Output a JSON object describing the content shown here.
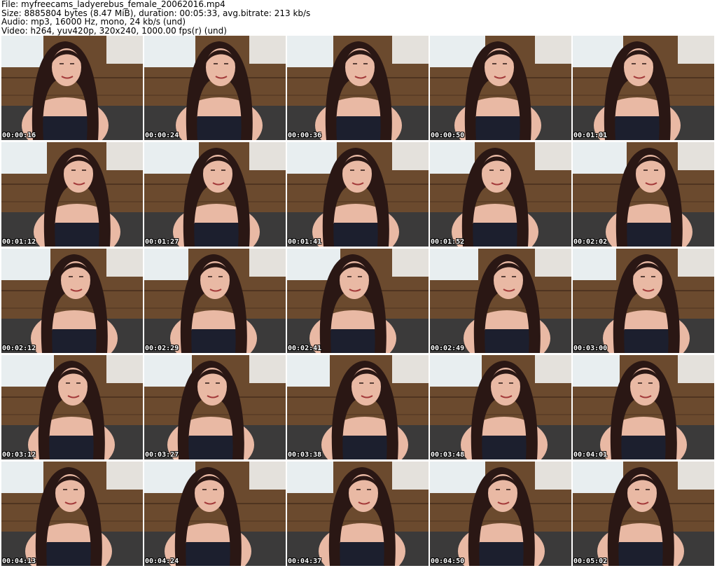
{
  "header": {
    "file": "File: myfreecams_ladyerebus_female_20062016.mp4",
    "size": "Size: 8885804 bytes (8.47 MiB), duration: 00:05:33, avg.bitrate: 213 kb/s",
    "audio": "Audio: mp3, 16000 Hz, mono, 24 kb/s (und)",
    "video": "Video: h264, yuv420p, 320x240, 1000.00 fps(r) (und)"
  },
  "thumbnails": [
    {
      "timestamp": "00:00:16"
    },
    {
      "timestamp": "00:00:24"
    },
    {
      "timestamp": "00:00:36"
    },
    {
      "timestamp": "00:00:50"
    },
    {
      "timestamp": "00:01:01"
    },
    {
      "timestamp": "00:01:12"
    },
    {
      "timestamp": "00:01:27"
    },
    {
      "timestamp": "00:01:41"
    },
    {
      "timestamp": "00:01:52"
    },
    {
      "timestamp": "00:02:02"
    },
    {
      "timestamp": "00:02:12"
    },
    {
      "timestamp": "00:02:29"
    },
    {
      "timestamp": "00:02:41"
    },
    {
      "timestamp": "00:02:49"
    },
    {
      "timestamp": "00:03:00"
    },
    {
      "timestamp": "00:03:12"
    },
    {
      "timestamp": "00:03:27"
    },
    {
      "timestamp": "00:03:38"
    },
    {
      "timestamp": "00:03:48"
    },
    {
      "timestamp": "00:04:01"
    },
    {
      "timestamp": "00:04:13"
    },
    {
      "timestamp": "00:04:24"
    },
    {
      "timestamp": "00:04:37"
    },
    {
      "timestamp": "00:04:50"
    },
    {
      "timestamp": "00:05:02"
    }
  ],
  "colors": {
    "wall": "#6b4a2e",
    "window": "#e8eef0",
    "hair": "#2a1714",
    "skin": "#e9b9a4",
    "dress": "#1c1f2e"
  }
}
